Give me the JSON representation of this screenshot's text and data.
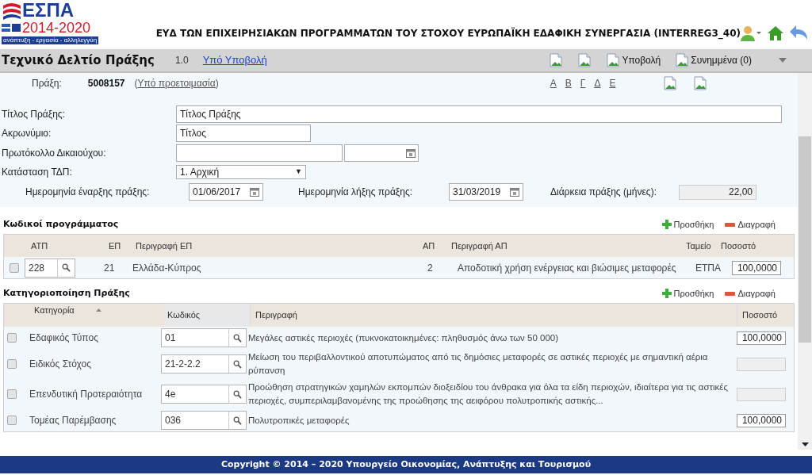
{
  "logo": {
    "name": "ΕΣΠΑ",
    "years": "2014-2020",
    "tagline": "ανάπτυξη - εργασία - αλληλεγγύη"
  },
  "header_title": "ΕΥΔ ΤΩΝ ΕΠΙΧΕΙΡΗΣΙΑΚΩΝ ΠΡΟΓΡΑΜΜΑΤΩΝ ΤΟΥ ΣΤΟΧΟΥ ΕΥΡΩΠΑΪΚΗ ΕΔΑΦΙΚΗ ΣΥΝΕΡΓΑΣΙΑ (INTERREG3_40)",
  "title_bar": {
    "title": "Τεχνικό Δελτίο Πράξης",
    "version": "1.0",
    "status_link": "Υπό Υποβολή",
    "actions": [
      {
        "kind": "icon"
      },
      {
        "kind": "icon"
      },
      {
        "kind": "button",
        "label": "Υποβολή"
      },
      {
        "kind": "button",
        "label": "Συνημμένα (0)"
      }
    ]
  },
  "sub_bar": {
    "label": "Πράξη:",
    "code": "5008157",
    "open": "(",
    "status_link": "Υπό προετοιμασία",
    "close": ")",
    "letters": [
      "Α",
      "Β",
      "Γ",
      "Δ",
      "Ε"
    ]
  },
  "form": {
    "title": {
      "label": "Τίτλος Πράξης:",
      "value": "Τίτλος Πράξης"
    },
    "acronym": {
      "label": "Ακρωνύμιο:",
      "value": "Τίτλος"
    },
    "protocol": {
      "label": "Πρωτόκολλο Δικαιούχου:"
    },
    "status": {
      "label": "Κατάσταση ΤΔΠ:",
      "value": "1. Αρχική",
      "arrow": "▼"
    },
    "start": {
      "label": "Ημερομηνία έναρξης πράξης:",
      "value": "01/06/2017"
    },
    "end": {
      "label": "Ημερομηνία λήξης πράξης:",
      "value": "31/03/2019"
    },
    "duration": {
      "label": "Διάρκεια πράξης (μήνες):",
      "value": "22,00"
    }
  },
  "program_codes": {
    "title": "Κωδικοί προγράμματος",
    "add": "Προσθήκη",
    "delete": "Διαγραφή",
    "columns": [
      "ΑΤΠ",
      "ΕΠ",
      "Περιγραφή ΕΠ",
      "ΑΠ",
      "Περιγραφή ΑΠ",
      "Ταμείο",
      "Ποσοστό"
    ],
    "rows": [
      {
        "checked": false,
        "atp": "228",
        "ep": "21",
        "ep_desc": "Ελλάδα-Κύπρος",
        "ap": "2",
        "ap_desc": "Αποδοτική χρήση ενέργειας και βιώσιμες μεταφορές",
        "fund": "ΕΤΠΑ",
        "percent": "100,0000"
      }
    ]
  },
  "categorization": {
    "title": "Κατηγοριοποίηση Πράξης",
    "add": "Προσθήκη",
    "delete": "Διαγραφή",
    "columns": [
      "Κατηγορία",
      "Κωδικός",
      "Περιγραφή",
      "Ποσοστό"
    ],
    "rows": [
      {
        "checked": false,
        "category": "Εδαφικός Τύπος",
        "code": "01",
        "description": "Μεγάλες αστικές περιοχές (πυκνοκατοικημένες: πληθυσμός άνω των 50 000)",
        "percent": "100,0000"
      },
      {
        "checked": false,
        "category": "Ειδικός Στόχος",
        "code": "21-2-2.2",
        "description": "Μείωση του περιβαλλοντικού αποτυπώματος από τις δημόσιες μεταφορές σε αστικές περιοχές με σημαντική αέρια ρύπανση",
        "percent": null
      },
      {
        "checked": false,
        "category": "Επενδυτική Προτεραιότητα",
        "code": "4e",
        "description": "Προώθηση στρατηγικών χαμηλών εκπομπών διοξειδίου του άνθρακα για όλα τα είδη περιοχών, ιδιαίτερα για τις αστικές περιοχές, συμπεριλαμβανομένης της προώθησης της αειφόρου πολυτροπικής αστικής...",
        "percent": null
      },
      {
        "checked": false,
        "category": "Τομέας Παρέμβασης",
        "code": "036",
        "description": "Πολυτροπικές μεταφορές",
        "percent": "100,0000"
      }
    ]
  },
  "footer": "Copyright © 2014 – 2020 Υπουργείο Οικονομίας, Ανάπτυξης και Τουρισμού"
}
